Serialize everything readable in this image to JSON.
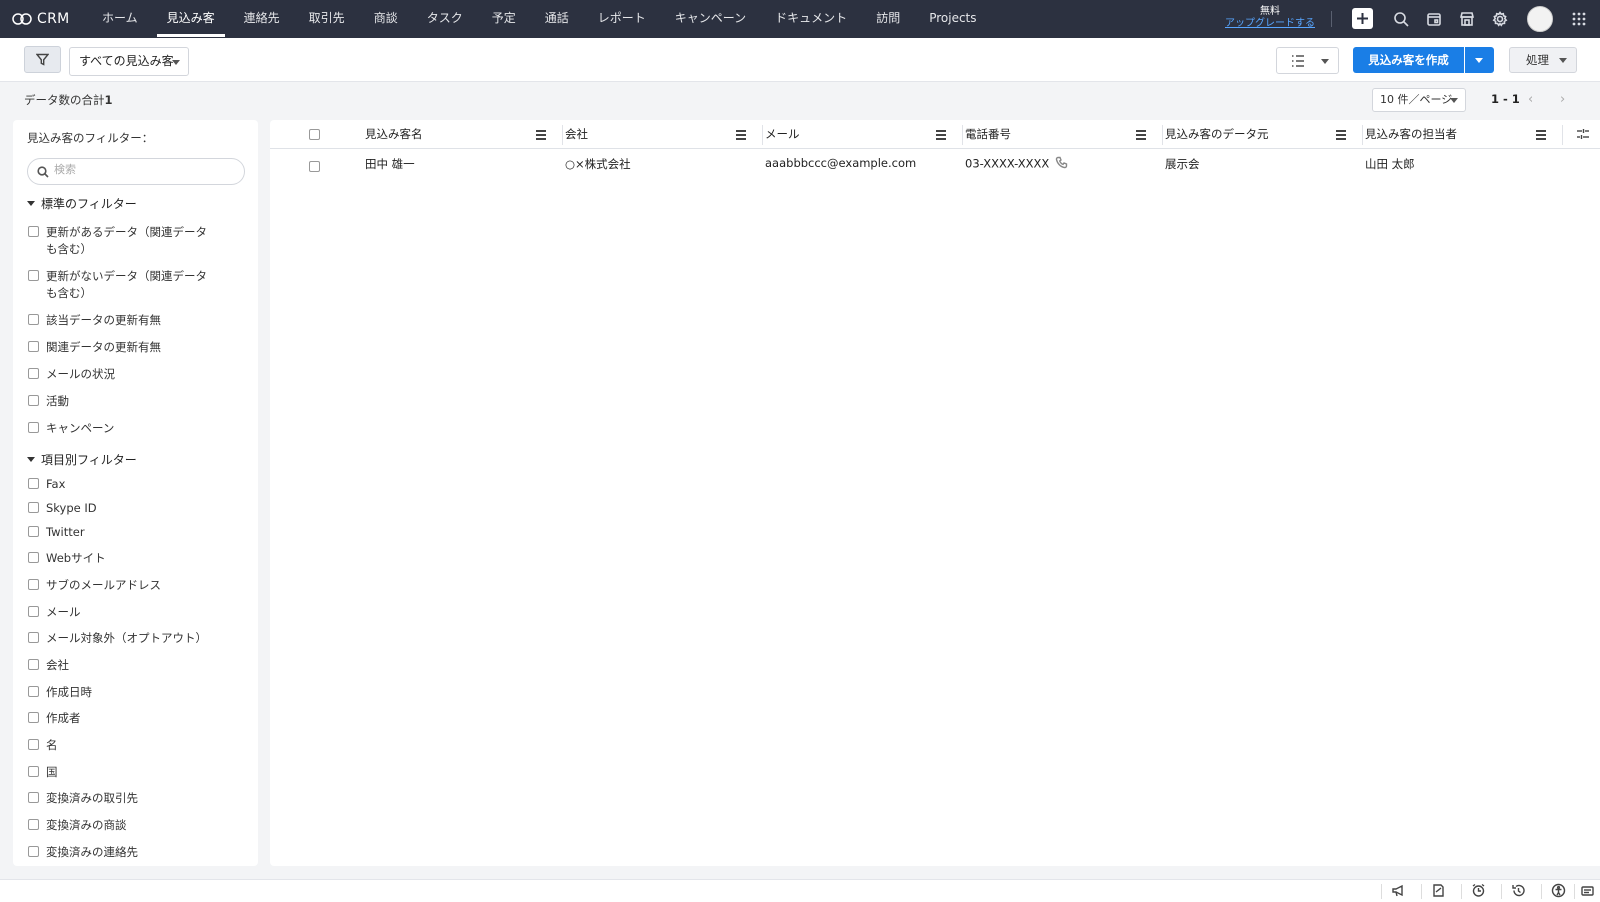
{
  "app": {
    "name": "CRM"
  },
  "nav": {
    "tabs": [
      {
        "label": "ホーム",
        "active": false
      },
      {
        "label": "見込み客",
        "active": true
      },
      {
        "label": "連絡先",
        "active": false
      },
      {
        "label": "取引先",
        "active": false
      },
      {
        "label": "商談",
        "active": false
      },
      {
        "label": "タスク",
        "active": false
      },
      {
        "label": "予定",
        "active": false
      },
      {
        "label": "通話",
        "active": false
      },
      {
        "label": "レポート",
        "active": false
      },
      {
        "label": "キャンペーン",
        "active": false
      },
      {
        "label": "ドキュメント",
        "active": false
      },
      {
        "label": "訪問",
        "active": false
      },
      {
        "label": "Projects",
        "active": false
      }
    ],
    "plan_label": "無料",
    "upgrade_label": "アップグレードする",
    "icons": [
      "plus-icon",
      "search-icon",
      "calendar-icon",
      "marketplace-icon",
      "settings-icon",
      "avatar",
      "apps-grid-icon"
    ]
  },
  "toolbar": {
    "view_selector": "すべての見込み客",
    "create_label": "見込み客を作成",
    "action_label": "処理"
  },
  "summary": {
    "total_label": "データ数の合計",
    "total_count": "1",
    "per_page": "10 件／ページ",
    "range": "1 - 1"
  },
  "filters": {
    "title": "見込み客のフィルター：",
    "search_placeholder": "検索",
    "standard_title": "標準のフィルター",
    "standard": [
      "更新があるデータ（関連データも含む）",
      "更新がないデータ（関連データも含む）",
      "該当データの更新有無",
      "関連データの更新有無",
      "メールの状況",
      "活動",
      "キャンペーン"
    ],
    "field_title": "項目別フィルター",
    "fields": [
      "Fax",
      "Skype ID",
      "Twitter",
      "Webサイト",
      "サブのメールアドレス",
      "メール",
      "メール対象外（オプトアウト）",
      "会社",
      "作成日時",
      "作成者",
      "名",
      "国",
      "変換済みの取引先",
      "変換済みの商談",
      "変換済みの連絡先"
    ]
  },
  "table": {
    "columns": [
      "見込み客名",
      "会社",
      "メール",
      "電話番号",
      "見込み客のデータ元",
      "見込み客の担当者"
    ],
    "rows": [
      {
        "name": "田中 雄一",
        "company": "○×株式会社",
        "email": "aaabbbccc@example.com",
        "phone": "03-XXXX-XXXX",
        "source": "展示会",
        "owner": "山田 太郎"
      }
    ]
  },
  "footer": {
    "icons": [
      "announcement-icon",
      "feedback-icon",
      "alarm-icon",
      "history-icon",
      "accessibility-icon",
      "notes-icon"
    ]
  }
}
